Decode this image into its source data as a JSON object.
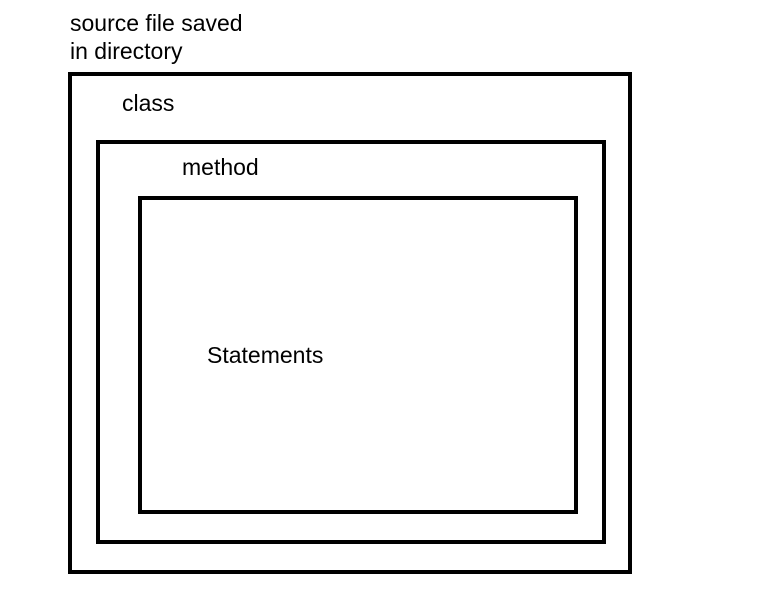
{
  "labels": {
    "top_line1": "source file saved",
    "top_line2": "in directory",
    "outer": "class",
    "middle": "method",
    "inner": "Statements"
  }
}
